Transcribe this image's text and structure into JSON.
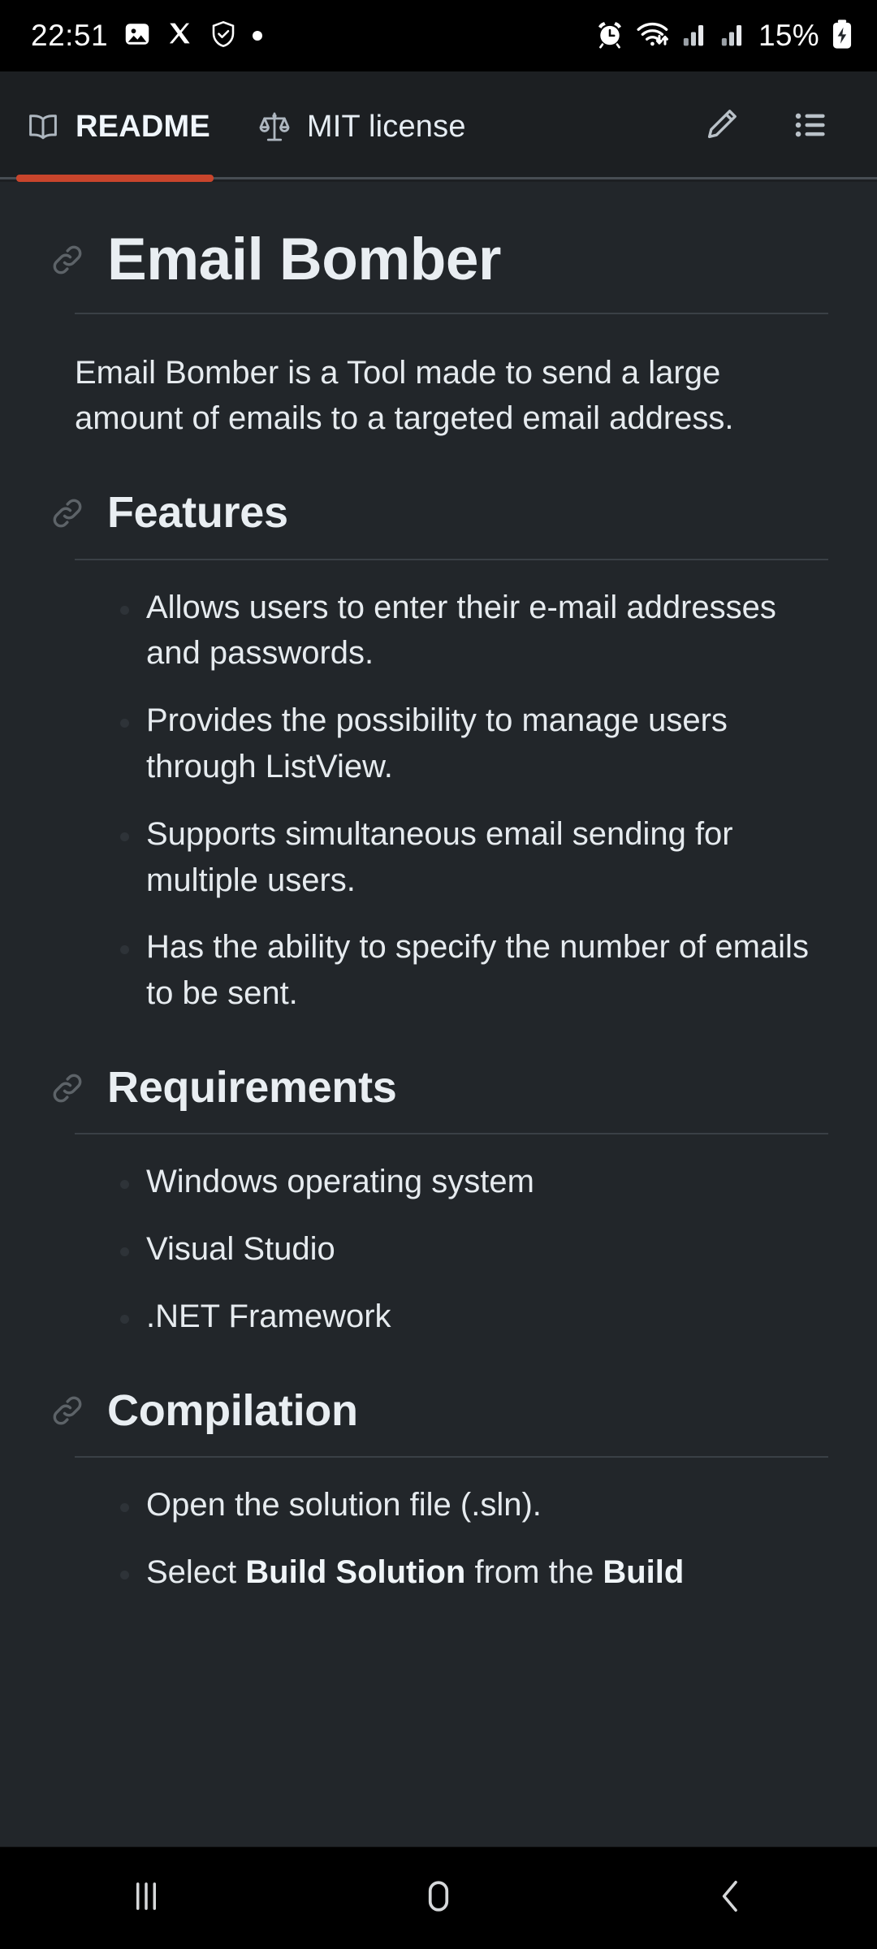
{
  "status_bar": {
    "time": "22:51",
    "battery_percent": "15%",
    "left_icons": [
      "gallery-icon",
      "x-twitter-icon",
      "shield-check-icon",
      "dot-indicator-icon"
    ],
    "right_icons": [
      "alarm-clock-icon",
      "wifi-icon",
      "signal-bars-1-icon",
      "signal-bars-2-icon",
      "battery-charging-icon"
    ]
  },
  "tabbar": {
    "tabs": [
      {
        "label": "README",
        "icon": "book-icon",
        "active": true
      },
      {
        "label": "MIT license",
        "icon": "scales-icon",
        "active": false
      }
    ],
    "actions": [
      {
        "name": "edit-button",
        "icon": "pencil-icon"
      },
      {
        "name": "outline-button",
        "icon": "list-outline-icon"
      }
    ],
    "active_underline_color": "#c9452c"
  },
  "readme": {
    "title": "Email Bomber",
    "intro": "Email Bomber is a Tool made to send a large amount of emails to a targeted email address.",
    "sections": [
      {
        "heading": "Features",
        "items": [
          "Allows users to enter their e-mail addresses and passwords.",
          "Provides the possibility to manage users through ListView.",
          "Supports simultaneous email sending for multiple users.",
          "Has the ability to specify the number of emails to be sent."
        ]
      },
      {
        "heading": "Requirements",
        "items": [
          "Windows operating system",
          "Visual Studio",
          ".NET Framework"
        ]
      },
      {
        "heading": "Compilation",
        "items": [
          "Open the solution file (.sln)."
        ],
        "partial_item_prefix": "Select ",
        "partial_item_bold1": "Build Solution",
        "partial_item_mid": " from the ",
        "partial_item_bold2": "Build"
      }
    ]
  },
  "navbar": {
    "buttons": [
      {
        "name": "recents-button",
        "icon": "recents-icon"
      },
      {
        "name": "home-button",
        "icon": "home-icon"
      },
      {
        "name": "back-button",
        "icon": "back-chevron-icon"
      }
    ]
  },
  "colors": {
    "accent": "#c9452c",
    "content_bg": "#22262a",
    "tabbar_bg": "#1c1f22",
    "text": "#e6ebef"
  }
}
